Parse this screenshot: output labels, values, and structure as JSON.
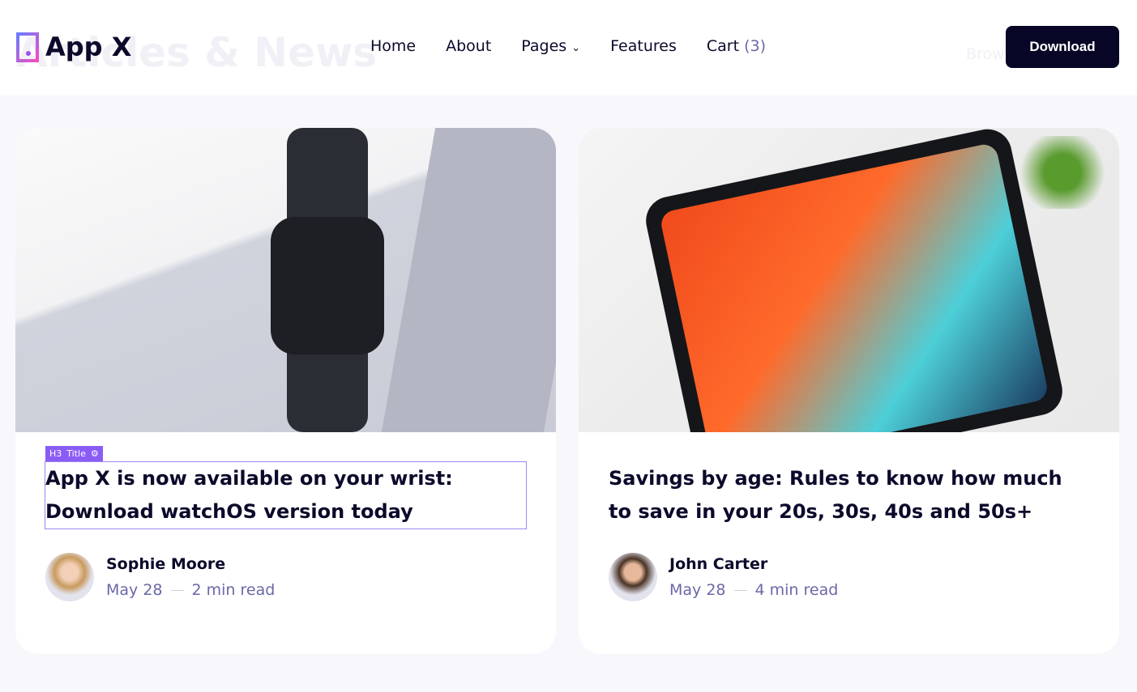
{
  "header": {
    "background_text": "Articles & News",
    "background_text2": "Brow",
    "logo": "App X",
    "nav": [
      {
        "label": "Home"
      },
      {
        "label": "About"
      },
      {
        "label": "Pages"
      },
      {
        "label": "Features"
      },
      {
        "label": "Cart",
        "count": "(3)"
      }
    ],
    "download": "Download"
  },
  "editor_tag": {
    "level": "H3",
    "label": "Title"
  },
  "cards": [
    {
      "title": "App X is now available on your wrist: Download watchOS version today",
      "author": "Sophie Moore",
      "date": "May 28",
      "read": "2 min read",
      "image": "apple-watch-airpods-laptop"
    },
    {
      "title": "Savings by age: Rules to know how much to save in your 20s, 30s, 40s and 50s+",
      "author": "John Carter",
      "date": "May 28",
      "read": "4 min read",
      "image": "ipad-on-desk"
    }
  ],
  "colors": {
    "primary": "#080626",
    "accent": "#8a5cf6",
    "meta": "#6a68a8"
  }
}
